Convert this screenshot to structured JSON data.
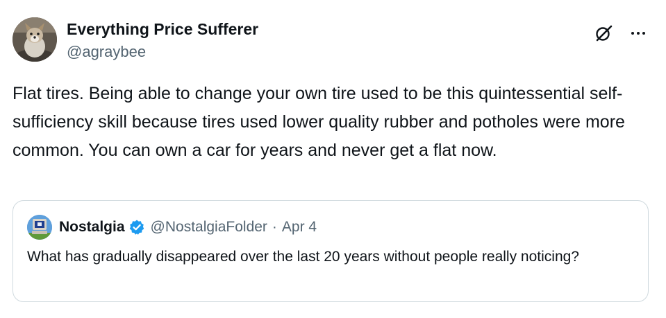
{
  "author": {
    "name": "Everything Price Sufferer",
    "handle": "@agraybee",
    "avatar_icon": "dog-photo-avatar"
  },
  "actions": {
    "grok_icon": "grok-icon",
    "more_icon": "more-options-icon"
  },
  "tweet": {
    "text": "Flat tires. Being able to change your own tire used to be this quintessential self-sufficiency skill because tires used lower quality rubber and potholes were more common. You can own a car for years and never get a flat now."
  },
  "quote": {
    "name": "Nostalgia",
    "handle": "@NostalgiaFolder",
    "separator": "·",
    "date": "Apr 4",
    "text": "What has gradually disappeared over the last 20 years without people really noticing?",
    "verified_icon": "verified-badge-icon",
    "avatar_icon": "retro-computer-avatar"
  },
  "colors": {
    "primary_text": "#0f1419",
    "secondary_text": "#536471",
    "border": "#cfd9de",
    "verified": "#1d9bf0"
  }
}
